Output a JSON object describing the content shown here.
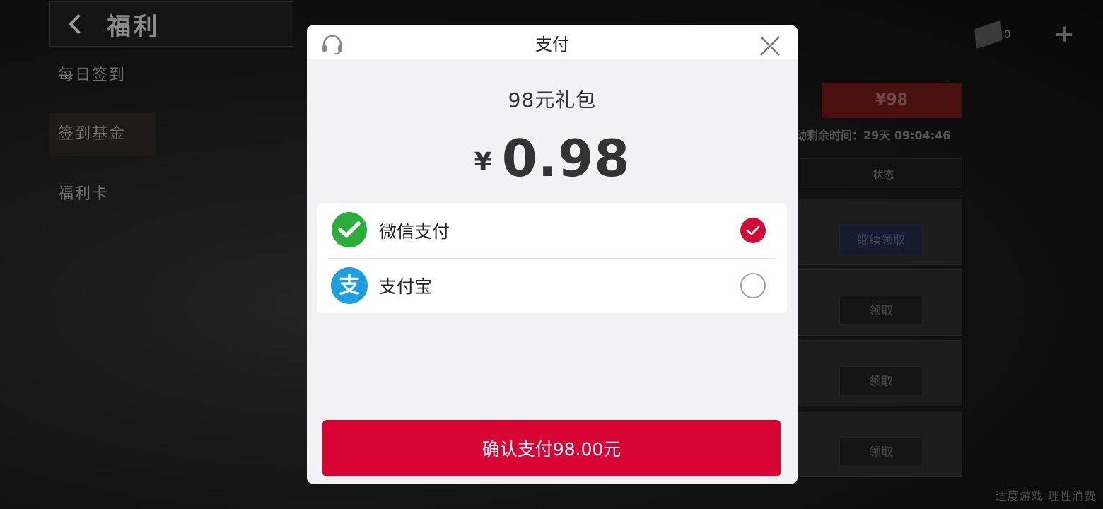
{
  "background": {
    "page_title": "福利",
    "nav_items": [
      "每日签到",
      "签到基金",
      "福利卡"
    ],
    "currency_count": "0",
    "price_badge": "¥98",
    "timer_text": "动剩余时间：29天 09:04:46",
    "status_header": "状态",
    "rows": [
      "继续领取",
      "领取",
      "领取",
      "领取"
    ],
    "footer": "适度游戏 理性消费"
  },
  "modal": {
    "title": "支付",
    "product_name": "98元礼包",
    "price_currency": "¥",
    "price_amount": "0.98",
    "methods": [
      {
        "label": "微信支付",
        "icon": "wechat-pay-icon",
        "selected": true,
        "color": "#2aae3a"
      },
      {
        "label": "支付宝",
        "icon": "alipay-icon",
        "selected": false,
        "color": "#1e9fe0"
      }
    ],
    "confirm_label": "确认支付98.00元",
    "accent_color": "#d80534"
  }
}
